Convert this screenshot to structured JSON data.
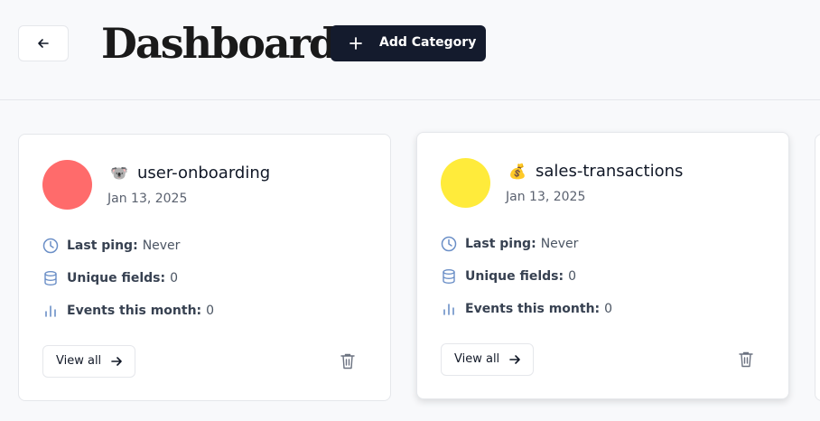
{
  "header": {
    "title": "Dashboard",
    "add_button_label": "Add Category"
  },
  "categories": [
    {
      "emoji": "🐨",
      "name": "user-onboarding",
      "date": "Jan 13, 2025",
      "color": "#ff6b6b",
      "stats": {
        "last_ping_label": "Last ping:",
        "last_ping_value": "Never",
        "unique_fields_label": "Unique fields:",
        "unique_fields_value": "0",
        "events_label": "Events this month:",
        "events_value": "0"
      },
      "view_all_label": "View all"
    },
    {
      "emoji": "💰",
      "name": "sales-transactions",
      "date": "Jan 13, 2025",
      "color": "#ffeb3b",
      "stats": {
        "last_ping_label": "Last ping:",
        "last_ping_value": "Never",
        "unique_fields_label": "Unique fields:",
        "unique_fields_value": "0",
        "events_label": "Events this month:",
        "events_value": "0"
      },
      "view_all_label": "View all"
    }
  ],
  "colors": {
    "accent": "#141b2d",
    "icon_blue": "#6b8fc7"
  },
  "icons": [
    "arrow-left-icon",
    "plus-icon",
    "clock-icon",
    "database-icon",
    "bar-chart-icon",
    "arrow-right-icon",
    "trash-icon"
  ]
}
